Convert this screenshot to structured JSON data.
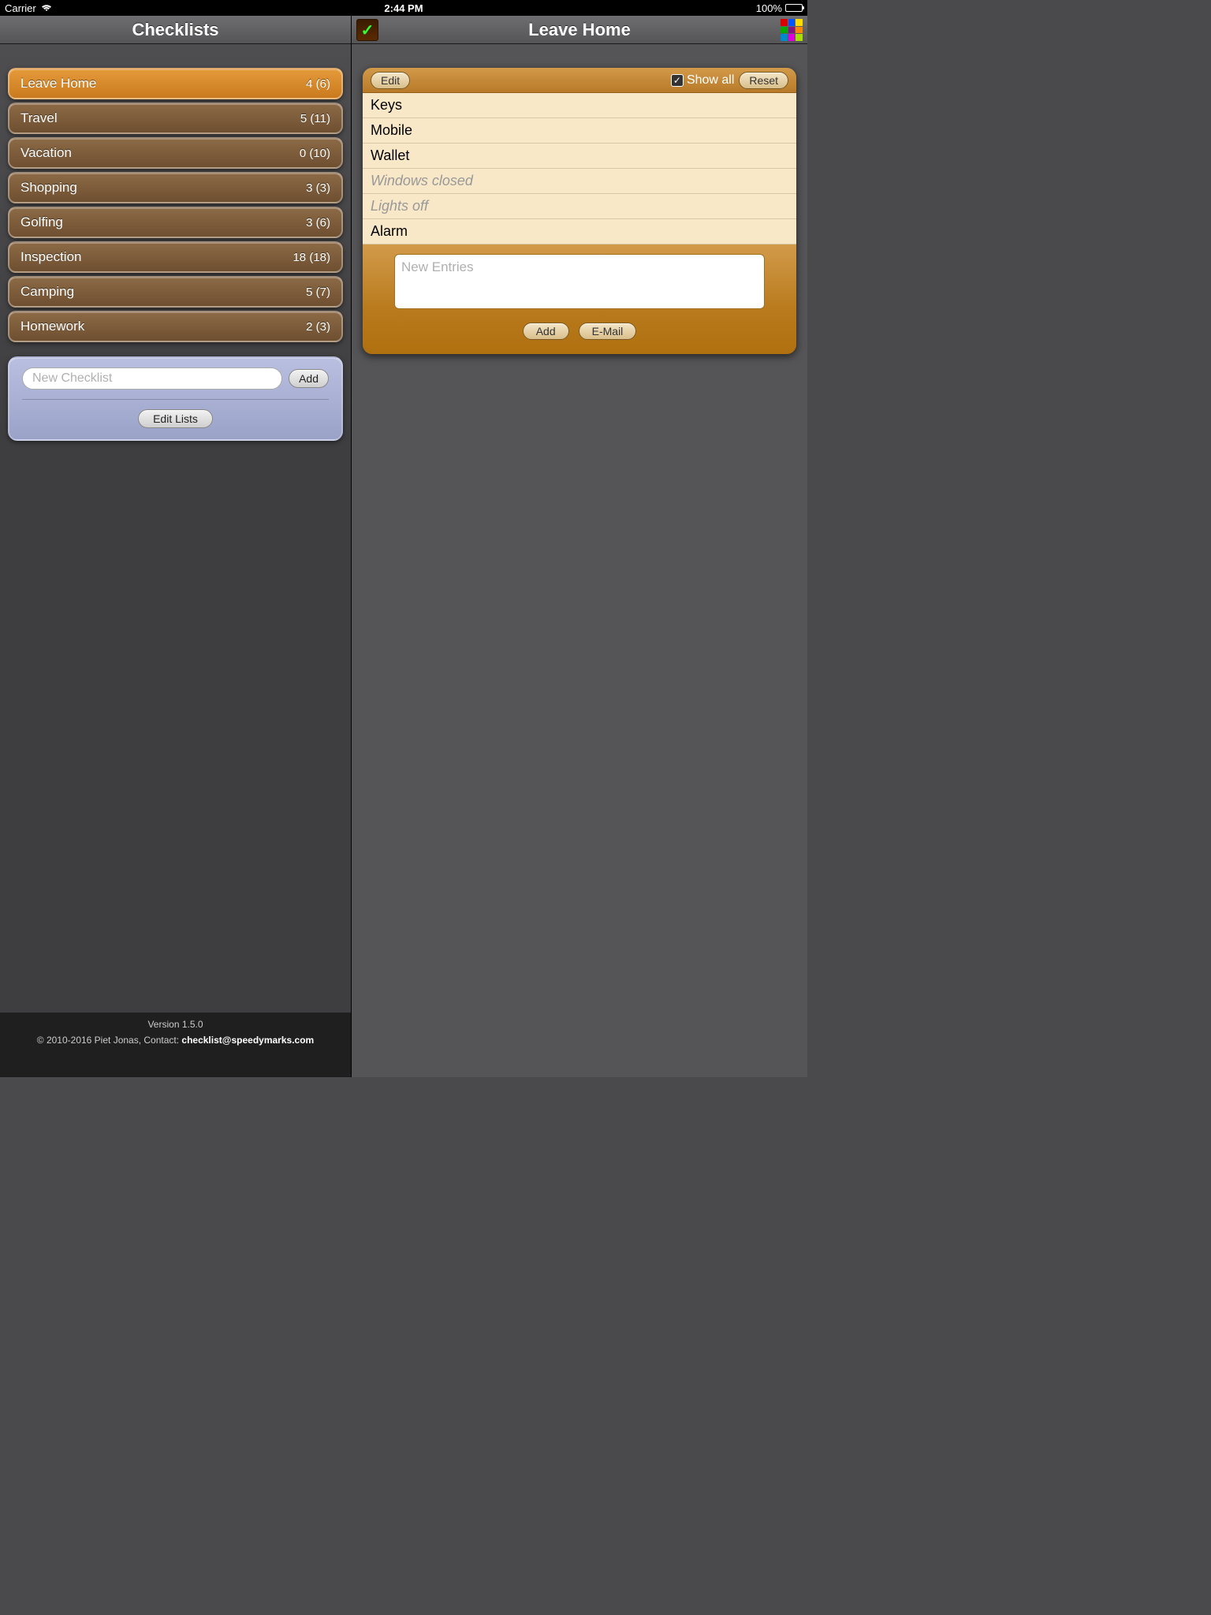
{
  "status": {
    "carrier": "Carrier",
    "time": "2:44 PM",
    "battery": "100%"
  },
  "sidebar": {
    "title": "Checklists",
    "lists": [
      {
        "name": "Leave Home",
        "count": "4 (6)",
        "selected": true
      },
      {
        "name": "Travel",
        "count": "5 (11)",
        "selected": false
      },
      {
        "name": "Vacation",
        "count": "0 (10)",
        "selected": false
      },
      {
        "name": "Shopping",
        "count": "3 (3)",
        "selected": false
      },
      {
        "name": "Golfing",
        "count": "3 (6)",
        "selected": false
      },
      {
        "name": "Inspection",
        "count": "18 (18)",
        "selected": false
      },
      {
        "name": "Camping",
        "count": "5 (7)",
        "selected": false
      },
      {
        "name": "Homework",
        "count": "2 (3)",
        "selected": false
      }
    ],
    "new_placeholder": "New Checklist",
    "add_label": "Add",
    "edit_lists_label": "Edit Lists"
  },
  "footer": {
    "version": "Version 1.5.0",
    "copyright_prefix": "© 2010-2016 Piet Jonas, Contact: ",
    "contact_email": "checklist@speedymarks.com"
  },
  "detail": {
    "title": "Leave Home",
    "edit_label": "Edit",
    "showall_label": "Show all",
    "reset_label": "Reset",
    "items": [
      {
        "text": "Keys",
        "done": false
      },
      {
        "text": "Mobile",
        "done": false
      },
      {
        "text": "Wallet",
        "done": false
      },
      {
        "text": "Windows closed",
        "done": true
      },
      {
        "text": "Lights off",
        "done": true
      },
      {
        "text": "Alarm",
        "done": false
      }
    ],
    "new_entries_placeholder": "New Entries",
    "add_label": "Add",
    "email_label": "E-Mail"
  },
  "colors": [
    "#d00",
    "#05f",
    "#fd0",
    "#0a0",
    "#818",
    "#f80",
    "#08c",
    "#d0d",
    "#ad0"
  ]
}
